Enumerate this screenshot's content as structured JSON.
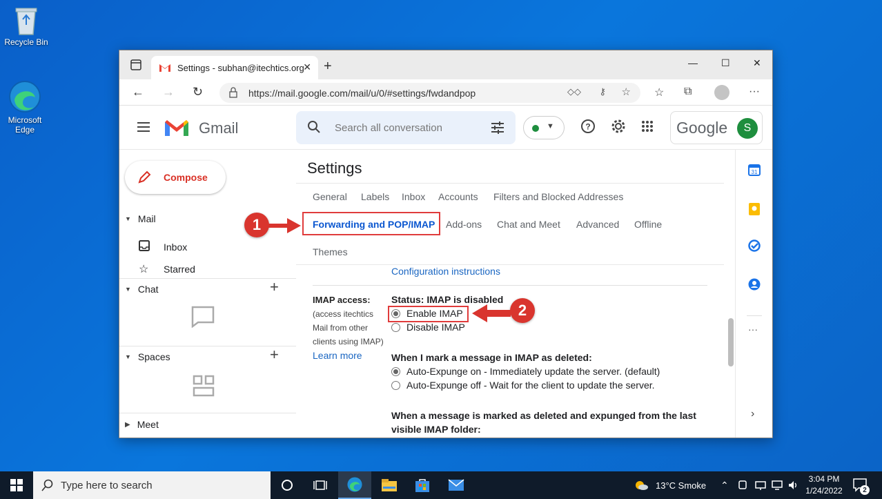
{
  "desktop": {
    "icons": [
      {
        "label": "Recycle Bin"
      },
      {
        "label": "Microsoft Edge"
      }
    ]
  },
  "browser": {
    "tab_title": "Settings - subhan@itechtics.org",
    "url": "https://mail.google.com/mail/u/0/#settings/fwdandpop"
  },
  "gmail": {
    "app_name": "Gmail",
    "search_placeholder": "Search all conversation",
    "google_word": "Google",
    "avatar_initial": "S",
    "compose_label": "Compose",
    "sidebar": {
      "mail_label": "Mail",
      "inbox_label": "Inbox",
      "starred_label": "Starred",
      "chat_label": "Chat",
      "spaces_label": "Spaces",
      "meet_label": "Meet"
    },
    "settings_title": "Settings",
    "tabs_row1": [
      "General",
      "Labels",
      "Inbox",
      "Accounts",
      "Filters and Blocked Addresses"
    ],
    "tabs_row2": [
      "Forwarding and POP/IMAP",
      "Add-ons",
      "Chat and Meet",
      "Advanced",
      "Offline"
    ],
    "tabs_row3": [
      "Themes"
    ],
    "config_link": "Configuration instructions",
    "imap": {
      "label": "IMAP access:",
      "desc1": "(access itechtics",
      "desc2": "Mail from other",
      "desc3": "clients using IMAP)",
      "learn_more": "Learn more",
      "status": "Status: IMAP is disabled",
      "enable": "Enable IMAP",
      "disable": "Disable IMAP",
      "deleted_heading": "When I mark a message in IMAP as deleted:",
      "expunge_on": "Auto-Expunge on - Immediately update the server. (default)",
      "expunge_off": "Auto-Expunge off - Wait for the client to update the server.",
      "expunged_heading1": "When a message is marked as deleted and expunged from the last",
      "expunged_heading2": "visible IMAP folder:"
    }
  },
  "annotations": {
    "badge1": "1",
    "badge2": "2",
    "color": "#d9352e"
  },
  "taskbar": {
    "search_placeholder": "Type here to search",
    "weather": "13°C  Smoke",
    "time": "3:04 PM",
    "date": "1/24/2022",
    "notification_count": "2"
  }
}
